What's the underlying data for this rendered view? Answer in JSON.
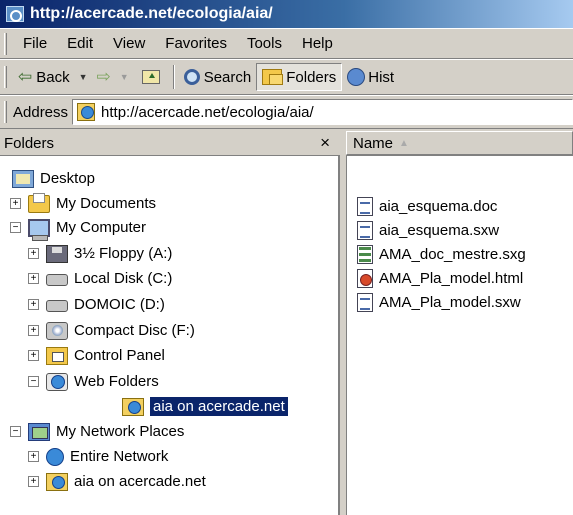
{
  "window": {
    "title": "http://acercade.net/ecologia/aia/"
  },
  "menu": [
    "File",
    "Edit",
    "View",
    "Favorites",
    "Tools",
    "Help"
  ],
  "toolbar": {
    "back": "Back",
    "search": "Search",
    "folders": "Folders",
    "history": "Hist"
  },
  "address": {
    "label": "Address",
    "value": "http://acercade.net/ecologia/aia/"
  },
  "folders_pane": {
    "title": "Folders",
    "close": "×"
  },
  "tree": [
    {
      "label": "Desktop",
      "icon": "desktop-icon"
    },
    {
      "label": "My Documents",
      "icon": "my-documents-icon",
      "toggle": "+"
    },
    {
      "label": "My Computer",
      "icon": "my-computer-icon",
      "toggle": "−"
    },
    {
      "label": "3½ Floppy (A:)",
      "icon": "floppy-icon",
      "toggle": "+"
    },
    {
      "label": "Local Disk (C:)",
      "icon": "hard-disk-icon",
      "toggle": "+"
    },
    {
      "label": "DOMOIC (D:)",
      "icon": "hard-disk-icon",
      "toggle": "+"
    },
    {
      "label": "Compact Disc (F:)",
      "icon": "cd-drive-icon",
      "toggle": "+"
    },
    {
      "label": "Control Panel",
      "icon": "control-panel-icon",
      "toggle": "+"
    },
    {
      "label": "Web Folders",
      "icon": "web-folders-icon",
      "toggle": "−"
    },
    {
      "label": "aia on acercade.net",
      "icon": "web-folder-icon",
      "selected": true
    },
    {
      "label": "My Network Places",
      "icon": "network-places-icon",
      "toggle": "−"
    },
    {
      "label": "Entire Network",
      "icon": "entire-network-icon",
      "toggle": "+"
    },
    {
      "label": "aia on acercade.net",
      "icon": "web-folder-icon",
      "toggle": "+"
    }
  ],
  "file_list": {
    "column_name": "Name",
    "files": [
      {
        "name": "aia_esquema.doc",
        "icon": "document-icon"
      },
      {
        "name": "aia_esquema.sxw",
        "icon": "document-icon"
      },
      {
        "name": "AMA_doc_mestre.sxg",
        "icon": "master-document-icon"
      },
      {
        "name": "AMA_Pla_model.html",
        "icon": "html-file-icon"
      },
      {
        "name": "AMA_Pla_model.sxw",
        "icon": "document-icon"
      }
    ]
  }
}
